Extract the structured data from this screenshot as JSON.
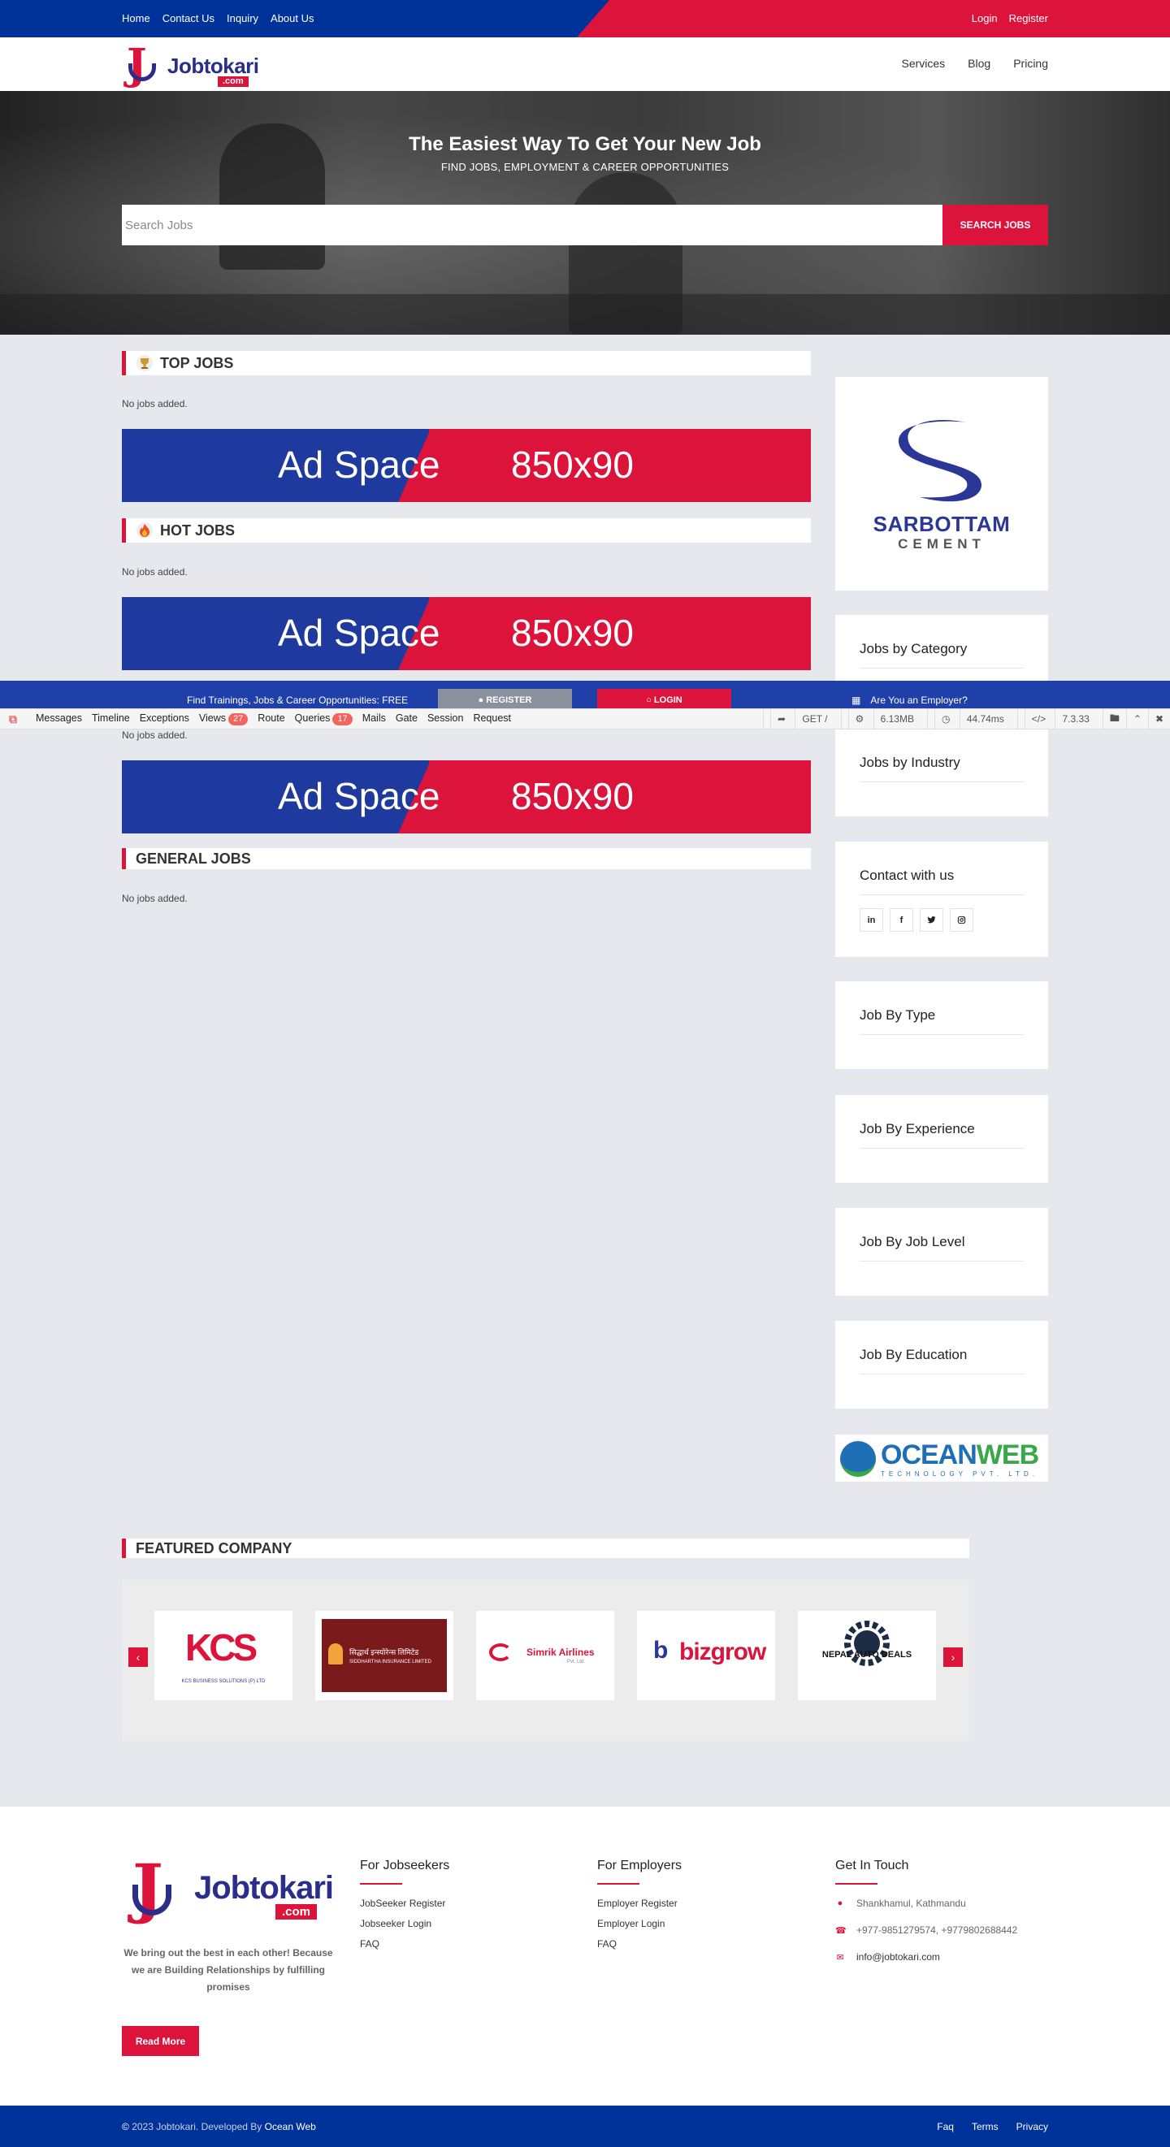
{
  "topbar": {
    "links": [
      "Home",
      "Contact Us",
      "Inquiry",
      "About Us"
    ],
    "login": "Login",
    "register": "Register"
  },
  "brand": {
    "name": "Jobtokari",
    "tld": ".com",
    "j": "J"
  },
  "nav": {
    "items": [
      "Services",
      "Blog",
      "Pricing"
    ]
  },
  "hero": {
    "title": "The Easiest Way To Get Your New Job",
    "subtitle": "FIND JOBS, EMPLOYMENT & CAREER OPPORTUNITIES",
    "search_placeholder": "Search Jobs",
    "search_button": "SEARCH JOBS"
  },
  "sections": {
    "top_jobs": "TOP JOBS",
    "hot_jobs": "HOT JOBS",
    "general_jobs": "GENERAL JOBS",
    "no_jobs": "No jobs added."
  },
  "ad": {
    "left": "Ad Space",
    "right": "850x90"
  },
  "sidebar": {
    "sponsor_name": "SARBOTTAM",
    "sponsor_sub": "CEMENT",
    "cards": [
      "Jobs by Category",
      "Jobs by Industry",
      "Contact with us",
      "Job By Type",
      "Job By Experience",
      "Job By Job Level",
      "Job By Education"
    ],
    "socials": [
      "in",
      "f",
      "t",
      "ig"
    ],
    "oceanweb": {
      "ocean": "OCEAN",
      "web": "WEB",
      "tech": "TECHNOLOGY PVT. LTD."
    }
  },
  "promo": {
    "text": "Find Trainings, Jobs & Career Opportunities: FREE",
    "register": "REGISTER",
    "login": "LOGIN",
    "employer": "Are You an Employer?"
  },
  "debugbar": {
    "tabs": [
      "Messages",
      "Timeline",
      "Exceptions",
      "Views",
      "Route",
      "Queries",
      "Mails",
      "Gate",
      "Session",
      "Request"
    ],
    "views_count": "27",
    "queries_count": "17",
    "method": "GET /",
    "memory": "6.13MB",
    "time": "44.74ms",
    "php": "7.3.33"
  },
  "featured": {
    "title": "FEATURED COMPANY",
    "companies": [
      "KCS",
      "KCS BUSINESS SOLUTIONS (P) LTD",
      "सिद्धार्थ इन्स्योरेन्स लिमिटेड",
      "SIDDHARTHA INSURANCE LIMITED",
      "Simrik Airlines",
      "Pvt. Ltd.",
      "bizgrow",
      "NEPAL AUTO DEALS"
    ]
  },
  "footer": {
    "tagline": "We bring out the best in each other! Because we are Building Relationships by fulfilling promises",
    "read_more": "Read More",
    "jobseekers": {
      "title": "For Jobseekers",
      "links": [
        "JobSeeker Register",
        "Jobseeker Login",
        "FAQ"
      ]
    },
    "employers": {
      "title": "For Employers",
      "links": [
        "Employer Register",
        "Employer Login",
        "FAQ"
      ]
    },
    "touch": {
      "title": "Get In Touch",
      "address": "Shankhamul, Kathmandu",
      "phone": "+977-9851279574, +9779802688442",
      "email": "info@jobtokari.com"
    }
  },
  "bottom": {
    "copyright": "2023 Jobtokari. Developed By",
    "developer": "Ocean Web",
    "links": [
      "Faq",
      "Terms",
      "Privacy"
    ]
  },
  "colors": {
    "blue": "#003399",
    "red": "#dc143c",
    "bg": "#e6e8ed"
  }
}
